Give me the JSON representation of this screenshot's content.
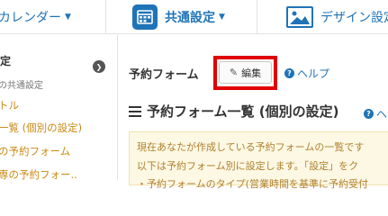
{
  "nav": {
    "calendar_label": "カレンダー",
    "common_settings_label": "共通設定",
    "design_label": "デザイン設定"
  },
  "sidebar": {
    "title": "定",
    "subtitle": "の共通設定",
    "items": [
      {
        "label": "トル"
      },
      {
        "label": "一覧 (個別の設定)"
      },
      {
        "label": "の予約フォーム"
      },
      {
        "label": "専の予約フォー.."
      }
    ]
  },
  "main": {
    "form_label": "予約フォーム",
    "edit_button": "編集",
    "help_label": "ヘルプ",
    "section_title": "予約フォーム一覧 (個別の設定)",
    "section_help": "ヘ",
    "notice_lines": [
      "現在あなたが作成している予約フォームの一覧です",
      "以下は予約フォーム別に設定します。「設定」をク",
      "・予約フォームのタイプ(営業時間を基準に予約受付"
    ]
  },
  "colors": {
    "accent": "#1f73b7",
    "link_orange": "#c88a14",
    "highlight_red": "#e00000",
    "notice_bg": "#fcf8e3"
  }
}
